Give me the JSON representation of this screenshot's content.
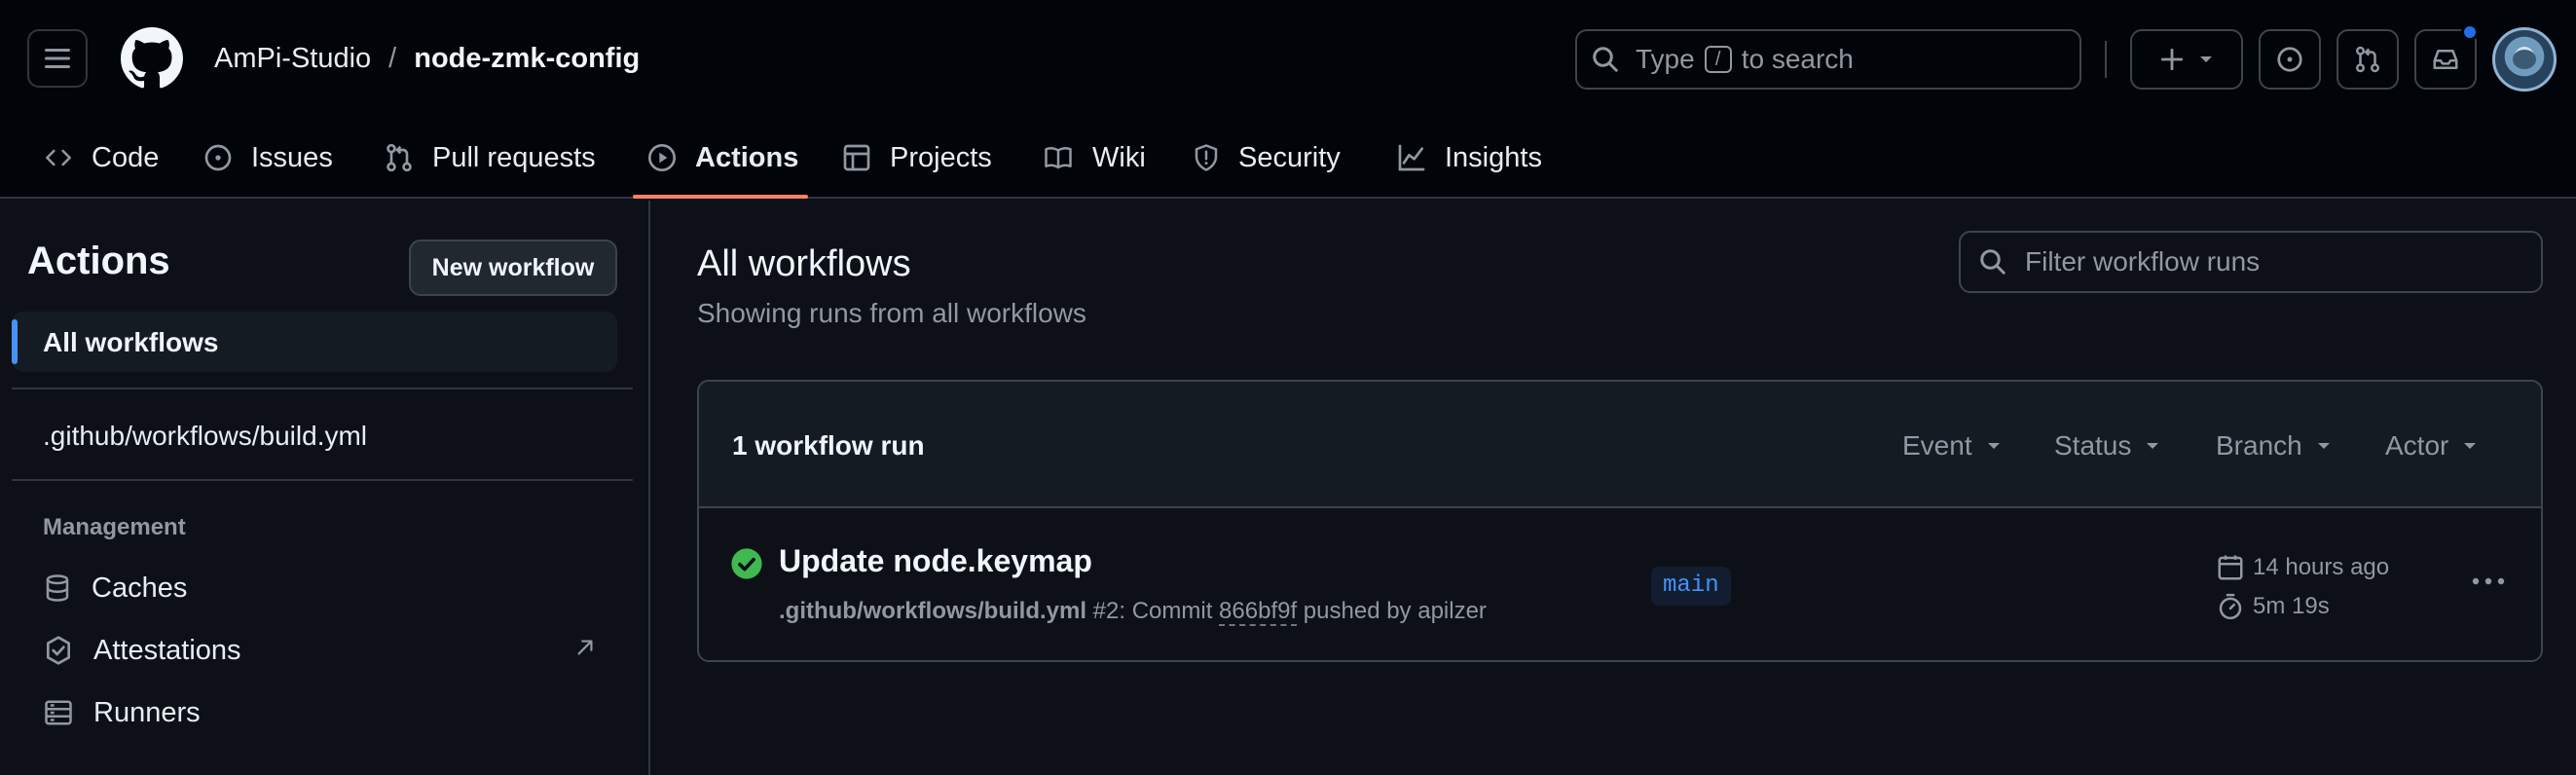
{
  "header": {
    "owner": "AmPi-Studio",
    "separator": "/",
    "repo": "node-zmk-config",
    "search": {
      "prefix": "Type",
      "key": "/",
      "suffix": "to search"
    }
  },
  "tabs": [
    {
      "label": "Code",
      "icon": "code-icon"
    },
    {
      "label": "Issues",
      "icon": "issue-icon"
    },
    {
      "label": "Pull requests",
      "icon": "pull-request-icon"
    },
    {
      "label": "Actions",
      "icon": "play-icon",
      "active": true
    },
    {
      "label": "Projects",
      "icon": "table-icon"
    },
    {
      "label": "Wiki",
      "icon": "book-icon"
    },
    {
      "label": "Security",
      "icon": "shield-icon"
    },
    {
      "label": "Insights",
      "icon": "graph-icon"
    }
  ],
  "sidebar": {
    "title": "Actions",
    "new_workflow": "New workflow",
    "all_workflows": "All workflows",
    "workflow_file": ".github/workflows/build.yml",
    "management_label": "Management",
    "management_items": [
      "Caches",
      "Attestations",
      "Runners"
    ]
  },
  "main": {
    "title": "All workflows",
    "subtitle": "Showing runs from all workflows",
    "filter_placeholder": "Filter workflow runs",
    "run_count": "1 workflow run",
    "filters": [
      "Event",
      "Status",
      "Branch",
      "Actor"
    ]
  },
  "run": {
    "title": "Update node.keymap",
    "workflow_file": ".github/workflows/build.yml",
    "number": "#2: Commit",
    "sha": "866bf9f",
    "pushed_by": "pushed by apilzer",
    "branch": "main",
    "time_ago": "14 hours ago",
    "duration": "5m 19s",
    "status": "success"
  },
  "colors": {
    "background": "#0d1117",
    "header_bg": "#010409",
    "accent_underline": "#f78166",
    "active_bar": "#4493f8",
    "success": "#3fb950",
    "notification_dot": "#1f6feb"
  }
}
